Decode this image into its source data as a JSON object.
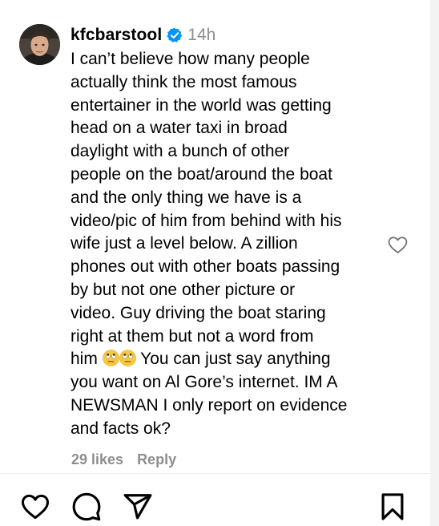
{
  "comment": {
    "username": "kfcbarstool",
    "timestamp": "14h",
    "verified_color": "#0095f6",
    "avatar_icon": "profile-photo",
    "lines": [
      "I can’t believe how many people",
      "actually think the most famous",
      "entertainer in the world was getting",
      "head on a water taxi in broad",
      "daylight with a bunch of other",
      "people on the boat/around the boat",
      "and the only thing we have is a",
      "video/pic of him from behind with his",
      "wife just a level below. A zillion",
      "phones out with other boats passing",
      "by but not one other picture or",
      "video. Guy driving the boat staring",
      "right at them but not a word from"
    ],
    "line_14_prefix": "him ",
    "line_14_emojis": [
      "face-with-rolling-eyes-emoji",
      "face-with-rolling-eyes-emoji"
    ],
    "line_14_suffix": " You can just say anything",
    "lines_after": [
      "you want on Al Gore’s internet. IM A",
      "NEWSMAN I only report on evidence",
      "and facts ok?"
    ],
    "likes_label": "29 likes",
    "reply_label": "Reply",
    "like_icon": "heart-outline-icon"
  },
  "action_bar": {
    "icons": [
      "heart-icon",
      "comment-icon",
      "share-icon",
      "bookmark-icon"
    ]
  }
}
